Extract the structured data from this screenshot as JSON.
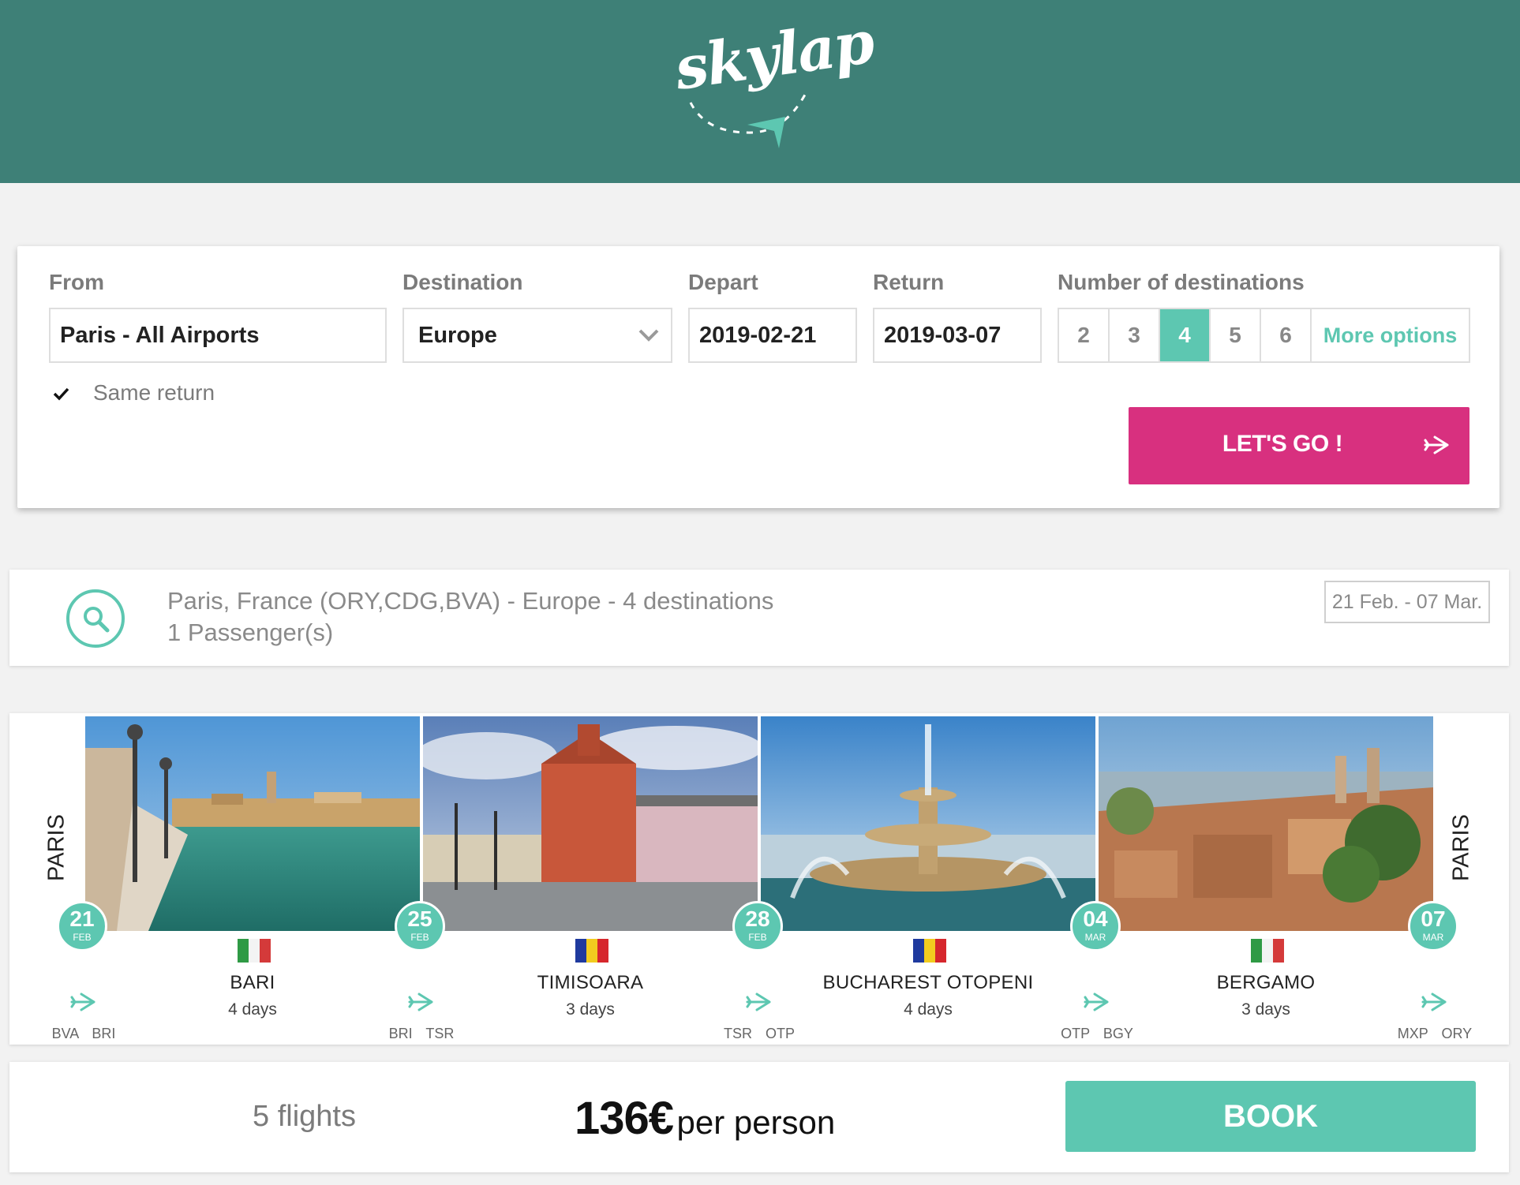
{
  "brand": {
    "name": "skylap",
    "header_color": "#3e8077",
    "accent": "#5dc7b1",
    "cta_color": "#d8307f"
  },
  "search": {
    "from_label": "From",
    "from_value": "Paris - All Airports",
    "destination_label": "Destination",
    "destination_value": "Europe",
    "depart_label": "Depart",
    "depart_value": "2019-02-21",
    "return_label": "Return",
    "return_value": "2019-03-07",
    "num_dest_label": "Number of destinations",
    "num_dest_options": [
      "2",
      "3",
      "4",
      "5",
      "6"
    ],
    "num_dest_selected": "4",
    "more_options_label": "More options",
    "same_return_label": "Same return",
    "same_return_checked": true,
    "go_label": "LET'S GO !"
  },
  "summary": {
    "line1": "Paris, France (ORY,CDG,BVA) - Europe - 4 destinations",
    "line2": "1 Passenger(s)",
    "date_range": "21 Feb. - 07 Mar."
  },
  "trip": {
    "origin_start": "PARIS",
    "origin_end": "PARIS",
    "stops": [
      {
        "city": "BARI",
        "days": "4 days",
        "country_flag": "italy",
        "image": "bari-harbor-photo"
      },
      {
        "city": "TIMISOARA",
        "days": "3 days",
        "country_flag": "romania",
        "image": "timisoara-square-photo"
      },
      {
        "city": "BUCHAREST OTOPENI",
        "days": "4 days",
        "country_flag": "romania",
        "image": "bucharest-fountain-photo"
      },
      {
        "city": "BERGAMO",
        "days": "3 days",
        "country_flag": "italy",
        "image": "bergamo-rooftops-photo"
      }
    ],
    "flights": [
      {
        "day": "21",
        "month": "FEB",
        "from": "BVA",
        "to": "BRI"
      },
      {
        "day": "25",
        "month": "FEB",
        "from": "BRI",
        "to": "TSR"
      },
      {
        "day": "28",
        "month": "FEB",
        "from": "TSR",
        "to": "OTP"
      },
      {
        "day": "04",
        "month": "MAR",
        "from": "OTP",
        "to": "BGY"
      },
      {
        "day": "07",
        "month": "MAR",
        "from": "MXP",
        "to": "ORY"
      }
    ]
  },
  "booking": {
    "flights_count": "5 flights",
    "price": "136€",
    "price_suffix": "per person",
    "book_label": "BOOK"
  }
}
